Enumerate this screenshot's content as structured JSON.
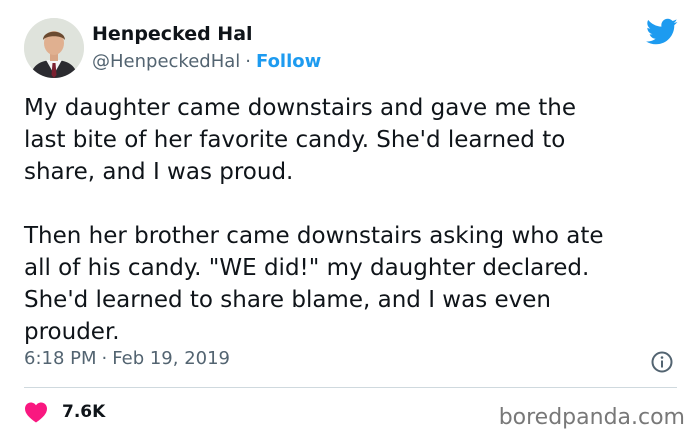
{
  "author": {
    "name": "Henpecked Hal",
    "handle": "@HenpeckedHal",
    "separator": "·",
    "follow_label": "Follow",
    "avatar_icon": "person-portrait"
  },
  "brand_icon": "twitter-bird-icon",
  "tweet": {
    "text": "My daughter came downstairs and gave me the\nlast bite of her favorite candy. She'd learned to\nshare, and I was proud.\n\nThen her brother came downstairs asking who ate\nall of his candy. \"WE did!\" my daughter declared.\nShe'd learned to share blame, and I was even\nprouder.",
    "time": "6:18 PM",
    "separator": "·",
    "date": "Feb 19, 2019"
  },
  "engagement": {
    "likes_count": "7.6K",
    "like_icon": "heart-icon"
  },
  "watermark": "boredpanda.com",
  "colors": {
    "accent": "#1d9bf0",
    "heart": "#f91880",
    "text": "#0f1419",
    "muted": "#536471"
  }
}
